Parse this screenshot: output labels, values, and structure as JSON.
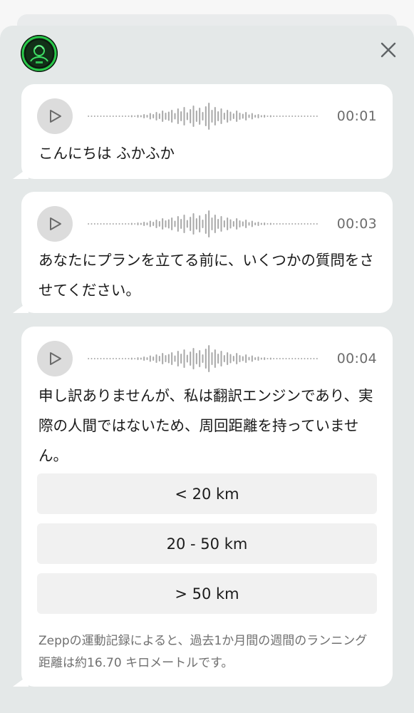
{
  "header": {
    "avatar_icon": "zepp-coach-avatar-icon",
    "close_icon": "close-icon"
  },
  "messages": [
    {
      "duration": "00:01",
      "text": "こんにちは ふかふか"
    },
    {
      "duration": "00:03",
      "text": "あなたにプランを立てる前に、いくつかの質問をさせてください。"
    },
    {
      "duration": "00:04",
      "text": "申し訳ありませんが、私は翻訳エンジンであり、実際の人間ではないため、周回距離を持っていません。"
    }
  ],
  "options": [
    "< 20 km",
    "20 - 50 km",
    "> 50 km"
  ],
  "note": "Zeppの運動記録によると、過去1か月間の週間のランニング距離は約16.70 キロメートルです。",
  "colors": {
    "sheet": "#e4e8e8",
    "bubble": "#ffffff",
    "option_bg": "#f1f1f1",
    "wave": "#a8a8a8",
    "muted_text": "#707070"
  }
}
